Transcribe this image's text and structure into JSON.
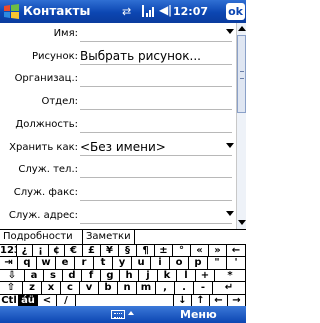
{
  "titlebar": {
    "title": "Контакты",
    "sync_icon": "sync-arrows-icon",
    "signal_icon": "signal-icon",
    "speaker_icon": "speaker-icon",
    "time": "12:07",
    "ok_label": "ok"
  },
  "form": {
    "fields": [
      {
        "label": "Имя:",
        "value": "",
        "dropdown": true
      },
      {
        "label": "Рисунок:",
        "value": "Выбрать рисунок..."
      },
      {
        "label": "Организац.:",
        "value": ""
      },
      {
        "label": "Отдел:",
        "value": ""
      },
      {
        "label": "Должность:",
        "value": ""
      },
      {
        "label": "Хранить как:",
        "value": "<Без имени>",
        "dropdown": true
      },
      {
        "label": "Служ. тел.:",
        "value": ""
      },
      {
        "label": "Служ. факс:",
        "value": ""
      },
      {
        "label": "Служ. адрес:",
        "value": "",
        "dropdown": true
      }
    ]
  },
  "tabs": [
    {
      "label": "Подробности",
      "active": true
    },
    {
      "label": "Заметки",
      "active": false
    }
  ],
  "keyboard": {
    "rows": [
      [
        "123",
        "¿",
        "¡",
        "¢",
        "€",
        "£",
        "¥",
        "§",
        "¶",
        "±",
        "°",
        "«",
        "»",
        "←"
      ],
      [
        "⇥",
        "q",
        "w",
        "e",
        "r",
        "t",
        "y",
        "u",
        "i",
        "o",
        "p",
        "\"",
        "'"
      ],
      [
        "⇩",
        "a",
        "s",
        "d",
        "f",
        "g",
        "h",
        "j",
        "k",
        "l",
        "+",
        "*"
      ],
      [
        "⇧",
        "z",
        "x",
        "c",
        "v",
        "b",
        "n",
        "m",
        ",",
        ".",
        "-",
        "↵"
      ],
      [
        "Ctl",
        "áü",
        "<",
        "/",
        "",
        "↓",
        "↑",
        "←",
        "→"
      ]
    ]
  },
  "menubar": {
    "keyboard_icon": "keyboard-icon",
    "menu_label": "Меню"
  }
}
